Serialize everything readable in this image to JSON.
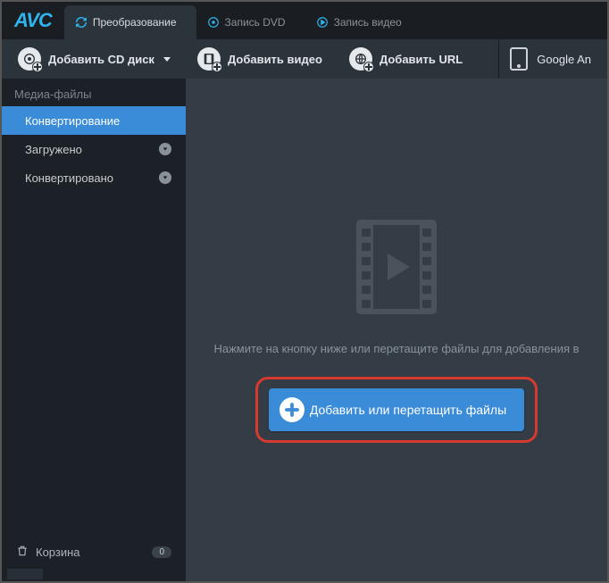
{
  "logo": "AVC",
  "tabs": [
    {
      "label": "Преобразование",
      "active": true
    },
    {
      "label": "Запись DVD",
      "active": false
    },
    {
      "label": "Запись видео",
      "active": false
    }
  ],
  "toolbar": {
    "add_cd": "Добавить CD диск",
    "add_video": "Добавить видео",
    "add_url": "Добавить URL",
    "device": "Google An"
  },
  "sidebar": {
    "header": "Медиа-файлы",
    "items": [
      {
        "label": "Конвертирование",
        "active": true,
        "badge": false
      },
      {
        "label": "Загружено",
        "active": false,
        "badge": true
      },
      {
        "label": "Конвертировано",
        "active": false,
        "badge": true
      }
    ],
    "trash": "Корзина",
    "trash_count": "0"
  },
  "content": {
    "hint": "Нажмите на кнопку ниже или перетащите файлы для добавления в",
    "add_button": "Добавить или перетащить файлы"
  }
}
